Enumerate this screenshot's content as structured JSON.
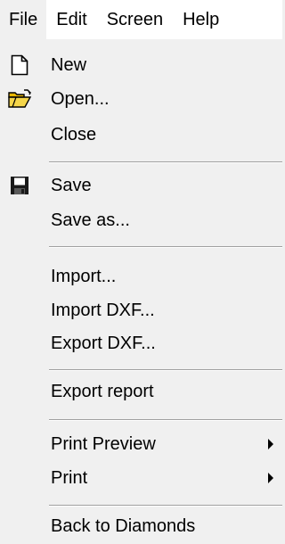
{
  "menubar": {
    "items": [
      {
        "label": "File"
      },
      {
        "label": "Edit"
      },
      {
        "label": "Screen"
      },
      {
        "label": "Help"
      }
    ]
  },
  "menu": {
    "new": {
      "label": "New",
      "icon": "new-document-icon"
    },
    "open": {
      "label": "Open...",
      "icon": "open-folder-icon"
    },
    "close": {
      "label": "Close"
    },
    "save": {
      "label": "Save",
      "icon": "floppy-disk-icon"
    },
    "save_as": {
      "label": "Save as..."
    },
    "import": {
      "label": "Import..."
    },
    "import_dxf": {
      "label": "Import DXF..."
    },
    "export_dxf": {
      "label": "Export DXF..."
    },
    "export_report": {
      "label": "Export report"
    },
    "print_preview": {
      "label": "Print Preview",
      "has_submenu": true
    },
    "print": {
      "label": "Print",
      "has_submenu": true
    },
    "back_to_diamonds": {
      "label": "Back to Diamonds"
    }
  }
}
